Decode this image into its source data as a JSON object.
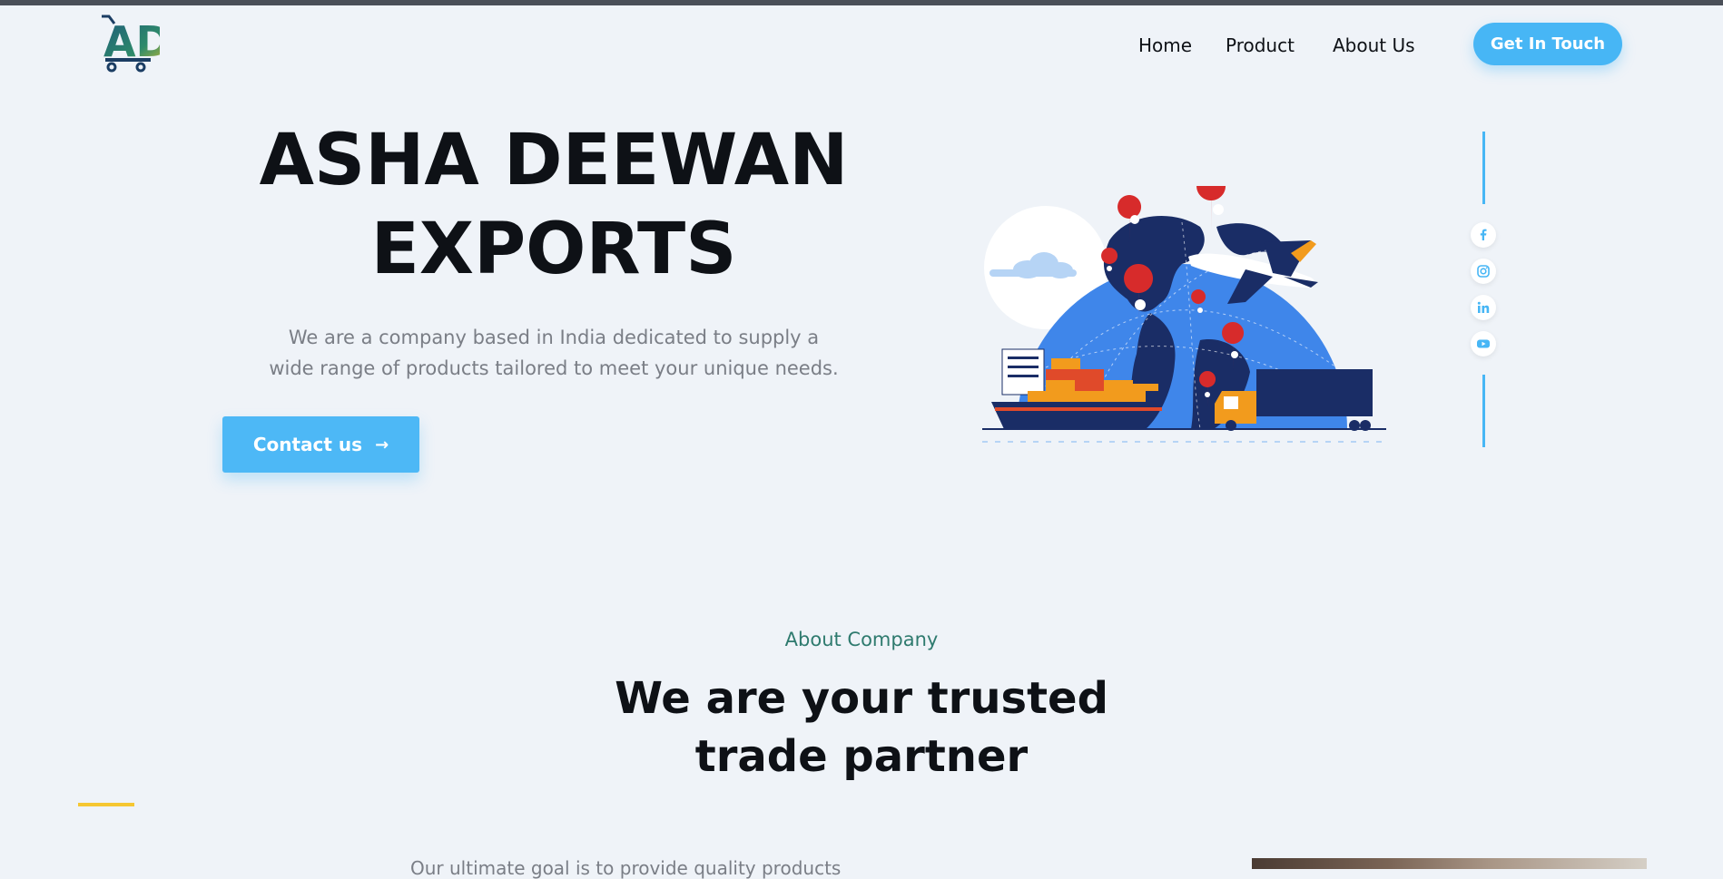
{
  "header": {
    "logo_text": "AD",
    "nav": [
      {
        "label": "Home"
      },
      {
        "label": "Product"
      },
      {
        "label": "About Us"
      }
    ],
    "cta_label": "Get In Touch"
  },
  "hero": {
    "title_line1": "ASHA DEEWAN",
    "title_line2": "EXPORTS",
    "subtitle_line1": "We are a company based in India dedicated to supply a",
    "subtitle_line2": "wide range of products tailored to meet your unique needs.",
    "contact_label": "Contact us",
    "contact_icon": "arrow-right-icon"
  },
  "social": [
    {
      "name": "facebook-icon"
    },
    {
      "name": "instagram-icon"
    },
    {
      "name": "linkedin-icon"
    },
    {
      "name": "youtube-icon"
    }
  ],
  "about": {
    "eyebrow": "About Company",
    "title_line1": "We are your trusted",
    "title_line2": "trade partner",
    "partial_text": "Our ultimate goal is to provide quality products"
  },
  "colors": {
    "accent_blue": "#47b6f5",
    "teal": "#2e7a6e",
    "yellow": "#f6c732",
    "background": "#eff3f8"
  }
}
